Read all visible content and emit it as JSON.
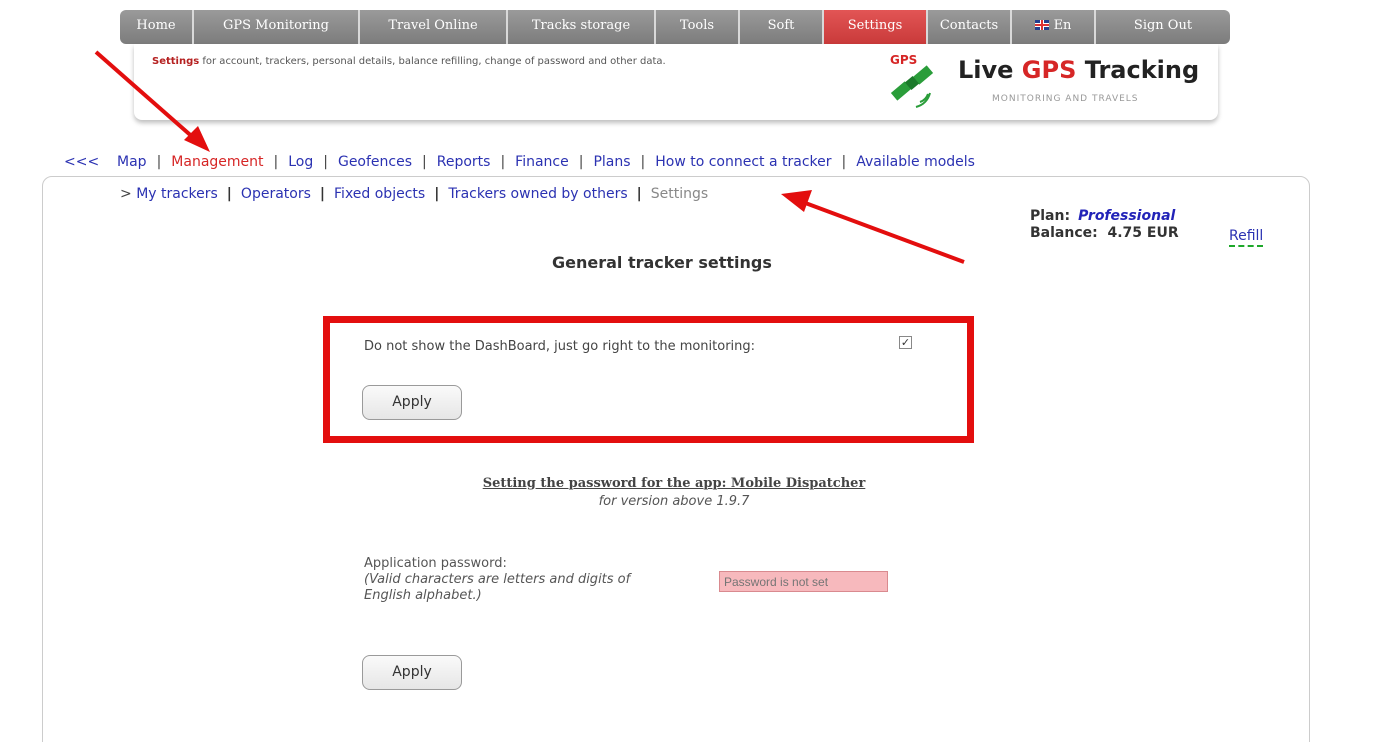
{
  "topnav": {
    "items": [
      {
        "label": "Home"
      },
      {
        "label": "GPS Monitoring"
      },
      {
        "label": "Travel Online"
      },
      {
        "label": "Tracks storage"
      },
      {
        "label": "Tools"
      },
      {
        "label": "Soft"
      },
      {
        "label": "Settings",
        "active": true
      },
      {
        "label": "Contacts"
      },
      {
        "label": "En",
        "icon": "uk-flag-icon"
      },
      {
        "label": "Sign Out"
      }
    ]
  },
  "banner": {
    "desc_bold": "Settings",
    "desc_rest": " for account, trackers, personal details, balance refilling, change of password and other data.",
    "logo_gps": "GPS",
    "logo_title_a": "Live ",
    "logo_title_b": "GPS",
    "logo_title_c": " Tracking",
    "logo_sub": "MONITORING AND TRAVELS"
  },
  "mainmenu": {
    "back": "<<<",
    "items": [
      "Map",
      "Management",
      "Log",
      "Geofences",
      "Reports",
      "Finance",
      "Plans",
      "How to connect a tracker",
      "Available models"
    ]
  },
  "submenu": {
    "prefix": ">",
    "items": [
      "My trackers",
      "Operators",
      "Fixed objects",
      "Trackers owned by others"
    ],
    "current": "Settings"
  },
  "account": {
    "plan_label": "Plan:",
    "plan_value": "Professional",
    "balance_label": "Balance:",
    "balance_value": "4.75 EUR",
    "refill": "Refill"
  },
  "general": {
    "title": "General tracker settings",
    "dashboard_label": "Do not show the DashBoard, just go right to the monitoring:",
    "dashboard_checked": true,
    "apply": "Apply"
  },
  "mobile": {
    "title": "Setting the password for the app: Mobile Dispatcher",
    "subtitle": "for version above 1.9.7",
    "pw_label": "Application password:",
    "pw_hint": "(Valid characters are letters and digits of English alphabet.)",
    "pw_placeholder": "Password is not set",
    "apply": "Apply"
  },
  "colors": {
    "accent_red": "#e30e0e",
    "link_blue": "#2b32b2",
    "nav_gray": "#8a8a8a"
  }
}
